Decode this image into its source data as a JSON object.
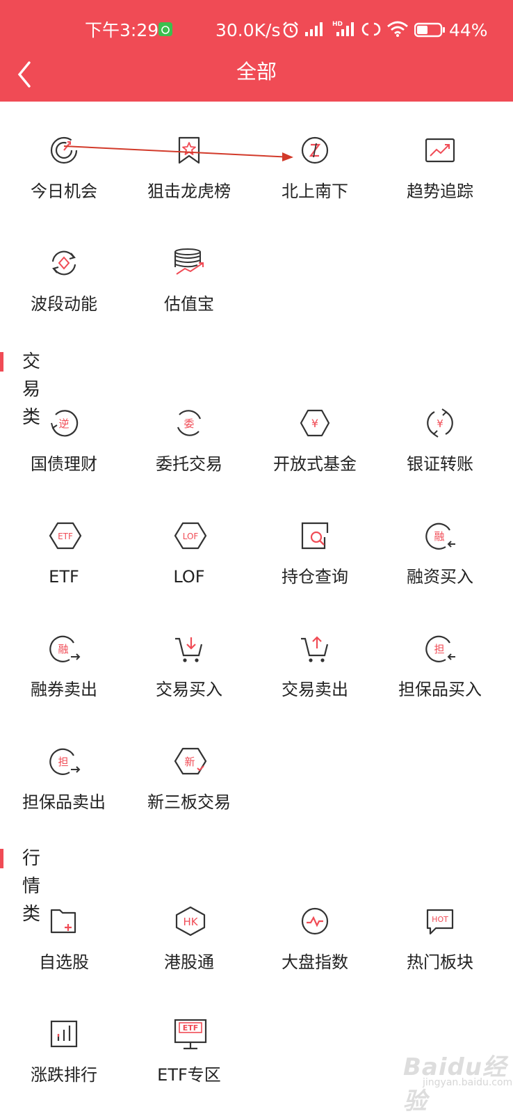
{
  "status_bar": {
    "time": "下午3:29",
    "speed": "30.0K/s",
    "battery": "44%"
  },
  "header": {
    "title": "全部"
  },
  "sections": [
    {
      "title": "",
      "items": [
        {
          "label": "今日机会",
          "icon": "target-icon"
        },
        {
          "label": "狙击龙虎榜",
          "icon": "bookmark-star-icon"
        },
        {
          "label": "北上南下",
          "icon": "north-south-icon"
        },
        {
          "label": "趋势追踪",
          "icon": "trend-chart-icon"
        },
        {
          "label": "波段动能",
          "icon": "cycle-diamond-icon"
        },
        {
          "label": "估值宝",
          "icon": "coin-stack-icon"
        }
      ]
    },
    {
      "title": "交易类",
      "items": [
        {
          "label": "国债理财",
          "icon": "reverse-repo-icon",
          "glyph": "逆"
        },
        {
          "label": "委托交易",
          "icon": "entrust-icon",
          "glyph": "委"
        },
        {
          "label": "开放式基金",
          "icon": "fund-hexagon-icon",
          "glyph": "¥"
        },
        {
          "label": "银证转账",
          "icon": "transfer-icon",
          "glyph": "¥"
        },
        {
          "label": "ETF",
          "icon": "etf-hexagon-icon",
          "glyph": "ETF"
        },
        {
          "label": "LOF",
          "icon": "lof-hexagon-icon",
          "glyph": "LOF"
        },
        {
          "label": "持仓查询",
          "icon": "position-search-icon"
        },
        {
          "label": "融资买入",
          "icon": "margin-buy-icon",
          "glyph": "融"
        },
        {
          "label": "融券卖出",
          "icon": "short-sell-icon",
          "glyph": "融"
        },
        {
          "label": "交易买入",
          "icon": "cart-down-icon"
        },
        {
          "label": "交易卖出",
          "icon": "cart-up-icon"
        },
        {
          "label": "担保品买入",
          "icon": "collateral-buy-icon",
          "glyph": "担"
        },
        {
          "label": "担保品卖出",
          "icon": "collateral-sell-icon",
          "glyph": "担"
        },
        {
          "label": "新三板交易",
          "icon": "neeq-hexagon-icon",
          "glyph": "新"
        }
      ]
    },
    {
      "title": "行情类",
      "items": [
        {
          "label": "自选股",
          "icon": "folder-plus-icon"
        },
        {
          "label": "港股通",
          "icon": "hk-hexagon-icon",
          "glyph": "HK"
        },
        {
          "label": "大盘指数",
          "icon": "index-pulse-icon"
        },
        {
          "label": "热门板块",
          "icon": "hot-bubble-icon",
          "glyph": "HOT"
        },
        {
          "label": "涨跌排行",
          "icon": "ranking-bars-icon"
        },
        {
          "label": "ETF专区",
          "icon": "etf-monitor-icon",
          "glyph": "ETF"
        }
      ]
    }
  ],
  "watermark": {
    "brand": "Baidu经验",
    "url": "jingyan.baidu.com"
  },
  "colors": {
    "accent": "#f04b55",
    "text": "#222222"
  }
}
